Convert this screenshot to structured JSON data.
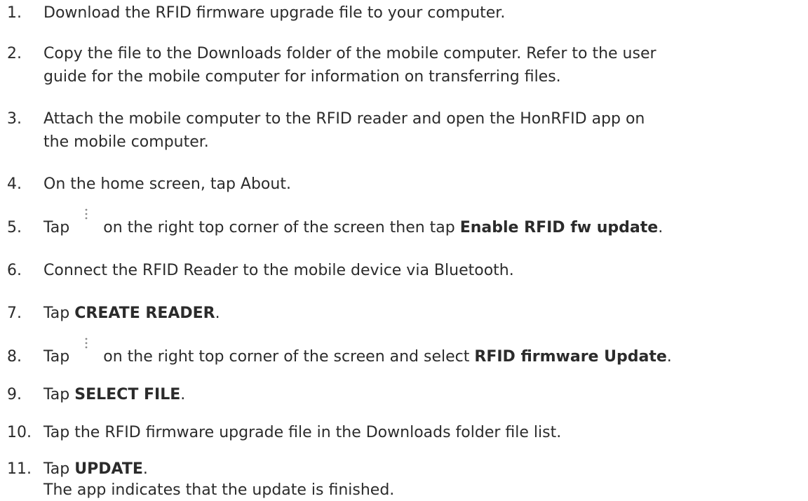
{
  "steps": [
    {
      "num": "1.",
      "parts": [
        {
          "t": "Download the RFID firmware upgrade file to your computer."
        }
      ]
    },
    {
      "num": "2.",
      "lines": [
        "Copy the file to the Downloads folder of the mobile computer. Refer to the user",
        "guide for the mobile computer for information on transferring files."
      ]
    },
    {
      "num": "3.",
      "lines": [
        "Attach the mobile computer to the RFID reader and open the HonRFID app on",
        "the mobile computer."
      ]
    },
    {
      "num": "4.",
      "parts": [
        {
          "t": "On the home screen, tap About."
        }
      ]
    },
    {
      "num": "5.",
      "pre": "Tap",
      "icon": "more-vert-icon",
      "mid": "on the right top corner of the screen then tap ",
      "bold": "Enable RFID fw update",
      "post": "."
    },
    {
      "num": "6.",
      "parts": [
        {
          "t": "Connect the RFID Reader to the mobile device via Bluetooth."
        }
      ]
    },
    {
      "num": "7.",
      "pre": "Tap ",
      "bold": "CREATE READER",
      "post": "."
    },
    {
      "num": "8.",
      "pre": "Tap",
      "icon": "more-vert-icon",
      "mid": "on the right top corner of the screen and select ",
      "bold": "RFID firmware Update",
      "post": "."
    },
    {
      "num": "9.",
      "pre": "Tap ",
      "bold": "SELECT FILE",
      "post": "."
    },
    {
      "num": "10.",
      "parts": [
        {
          "t": "Tap the RFID firmware upgrade file in the Downloads folder file list."
        }
      ]
    },
    {
      "num": "11.",
      "pre": "Tap ",
      "bold": "UPDATE",
      "post": ".",
      "note": "The app indicates that the update is finished."
    }
  ]
}
